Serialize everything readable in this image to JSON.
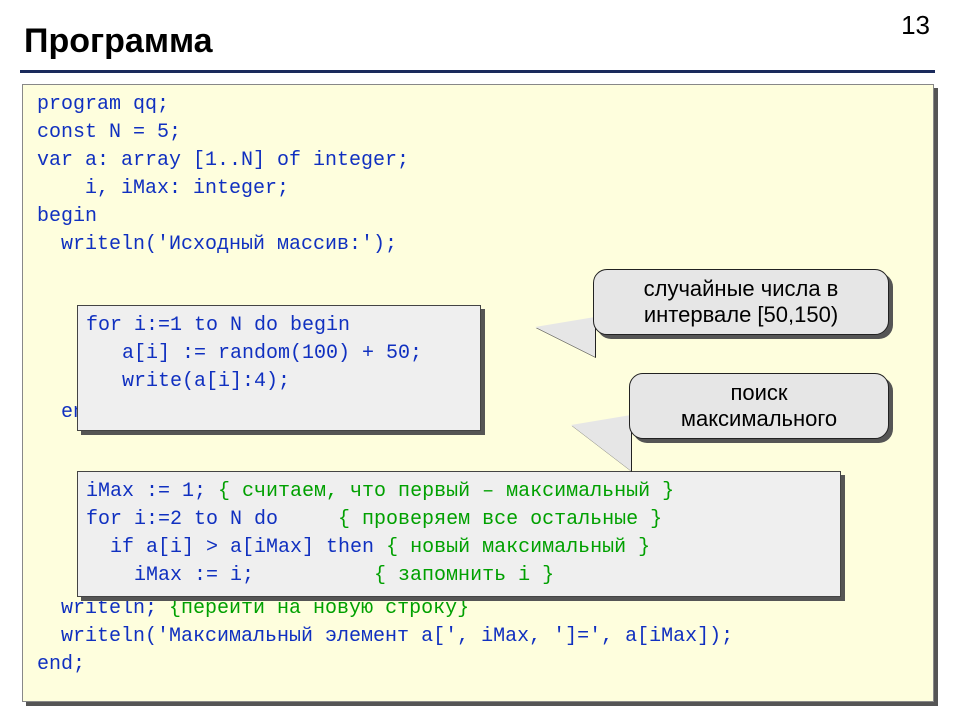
{
  "page_number": "13",
  "title": "Программа",
  "code": {
    "line1": "program qq;",
    "line2": "const N = 5;",
    "line3": "var a: array [1..N] of integer;",
    "line4": "    i, iMax: integer;",
    "line5": "begin",
    "line6": "  writeln('Исходный массив:');",
    "box1_line1": "for i:=1 to N do begin",
    "box1_line2": "   a[i] := random(100) + 50;",
    "box1_line3": "   write(a[i]:4);",
    "box1_end": "end;",
    "box2_line1": "iMax := 1; ",
    "box2_comment1": "{ считаем, что первый – максимальный }",
    "box2_line2": "for i:=2 to N do     ",
    "box2_comment2": "{ проверяем все остальные }",
    "box2_line3": "  if a[i] > a[iMax] then ",
    "box2_comment3": "{ новый максимальный }",
    "box2_line4": "    iMax := i;          ",
    "box2_comment4": "{ запомнить i }",
    "after1": "  writeln; ",
    "after1_comment": "{перейти на новую строку}",
    "after2": "  writeln('Максимальный элемент a[', iMax, ']=', a[iMax]);",
    "end": "end;"
  },
  "callouts": {
    "c1": "случайные числа в\nинтервале [50,150)",
    "c2": "поиск\nмаксимального"
  }
}
